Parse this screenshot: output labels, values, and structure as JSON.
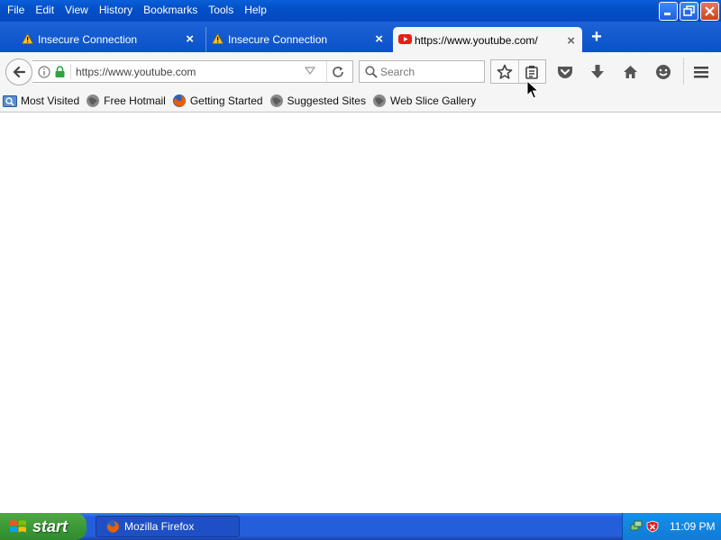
{
  "menu": [
    {
      "accel": "F",
      "rest": "ile"
    },
    {
      "accel": "E",
      "rest": "dit"
    },
    {
      "accel": "V",
      "rest": "iew"
    },
    {
      "accel": "",
      "prefix": "Hi",
      "accel2": "s",
      "rest": "tory"
    },
    {
      "accel": "B",
      "rest": "ookmarks"
    },
    {
      "accel": "T",
      "rest": "ools"
    },
    {
      "accel": "H",
      "rest": "elp"
    }
  ],
  "menu_labels": [
    "File",
    "Edit",
    "View",
    "History",
    "Bookmarks",
    "Tools",
    "Help"
  ],
  "tabs": [
    {
      "label": "Insecure Connection",
      "icon": "warning-icon"
    },
    {
      "label": "Insecure Connection",
      "icon": "warning-icon"
    },
    {
      "label": "https://www.youtube.com/",
      "icon": "youtube-icon",
      "active": true
    }
  ],
  "new_tab_symbol": "+",
  "close_symbol": "×",
  "url": {
    "value": "https://www.youtube.com"
  },
  "search": {
    "placeholder": "Search"
  },
  "bookmarks": [
    {
      "label": "Most Visited",
      "icon": "most-visited-icon"
    },
    {
      "label": "Free Hotmail",
      "icon": "globe-icon"
    },
    {
      "label": "Getting Started",
      "icon": "firefox-icon"
    },
    {
      "label": "Suggested Sites",
      "icon": "globe-icon"
    },
    {
      "label": "Web Slice Gallery",
      "icon": "globe-icon"
    }
  ],
  "taskbar": {
    "start_label": "start",
    "task_label": "Mozilla Firefox",
    "clock": "11:09 PM"
  },
  "colors": {
    "xp_blue": "#0a52c8",
    "start_green": "#3c9a37",
    "toolbar_bg": "#f5f5f5"
  }
}
